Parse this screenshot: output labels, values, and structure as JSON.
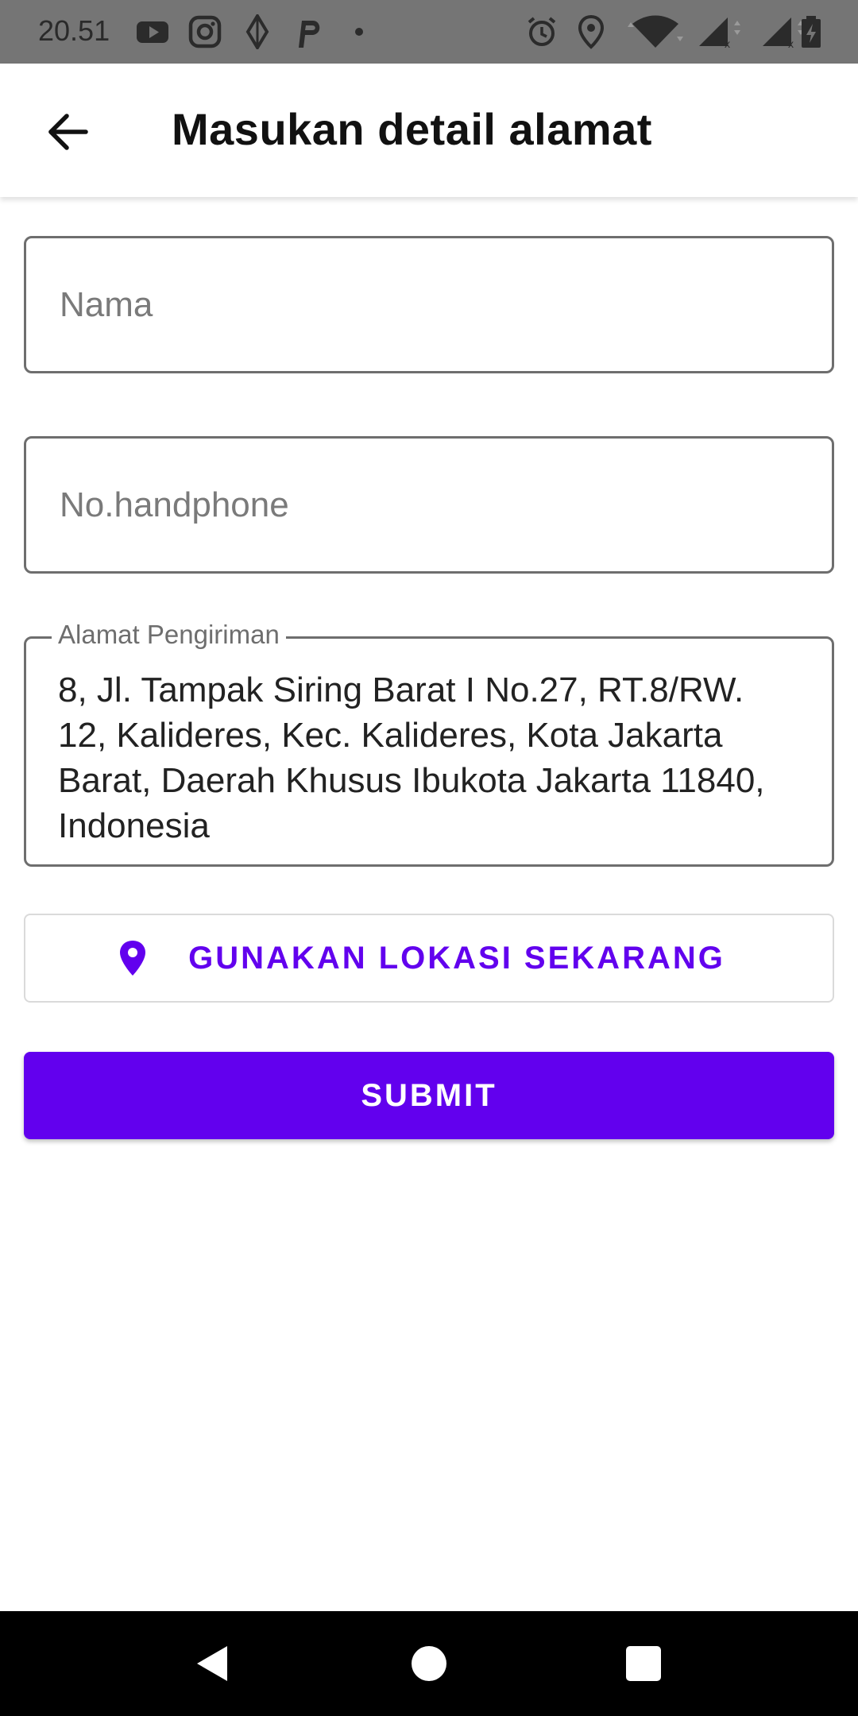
{
  "status_bar": {
    "time": "20.51",
    "left_icons": [
      "youtube-icon",
      "instagram-icon",
      "navigation-icon",
      "parking-icon",
      "dot-icon"
    ],
    "right_icons": [
      "alarm-icon",
      "location-icon",
      "wifi-icon",
      "signal-icon",
      "signal-icon",
      "battery-icon"
    ]
  },
  "app_bar": {
    "title": "Masukan detail alamat",
    "back_icon": "arrow-back-icon"
  },
  "form": {
    "name": {
      "placeholder": "Nama",
      "value": ""
    },
    "phone": {
      "placeholder": "No.handphone",
      "value": ""
    },
    "address": {
      "label": "Alamat Pengiriman",
      "value": "8, Jl. Tampak Siring Barat I No.27, RT.8/RW. 12, Kalideres, Kec. Kalideres, Kota Jakarta Barat, Daerah Khusus Ibukota Jakarta 11840, Indonesia"
    }
  },
  "buttons": {
    "use_location": "GUNAKAN LOKASI SEKARANG",
    "submit": "SUBMIT"
  },
  "colors": {
    "accent": "#6200ee",
    "status_bar": "#757575",
    "nav_bar": "#000000",
    "field_border": "#6e6e6e"
  },
  "nav_bar": {
    "icons": [
      "back-triangle-icon",
      "home-circle-icon",
      "recents-square-icon"
    ]
  }
}
